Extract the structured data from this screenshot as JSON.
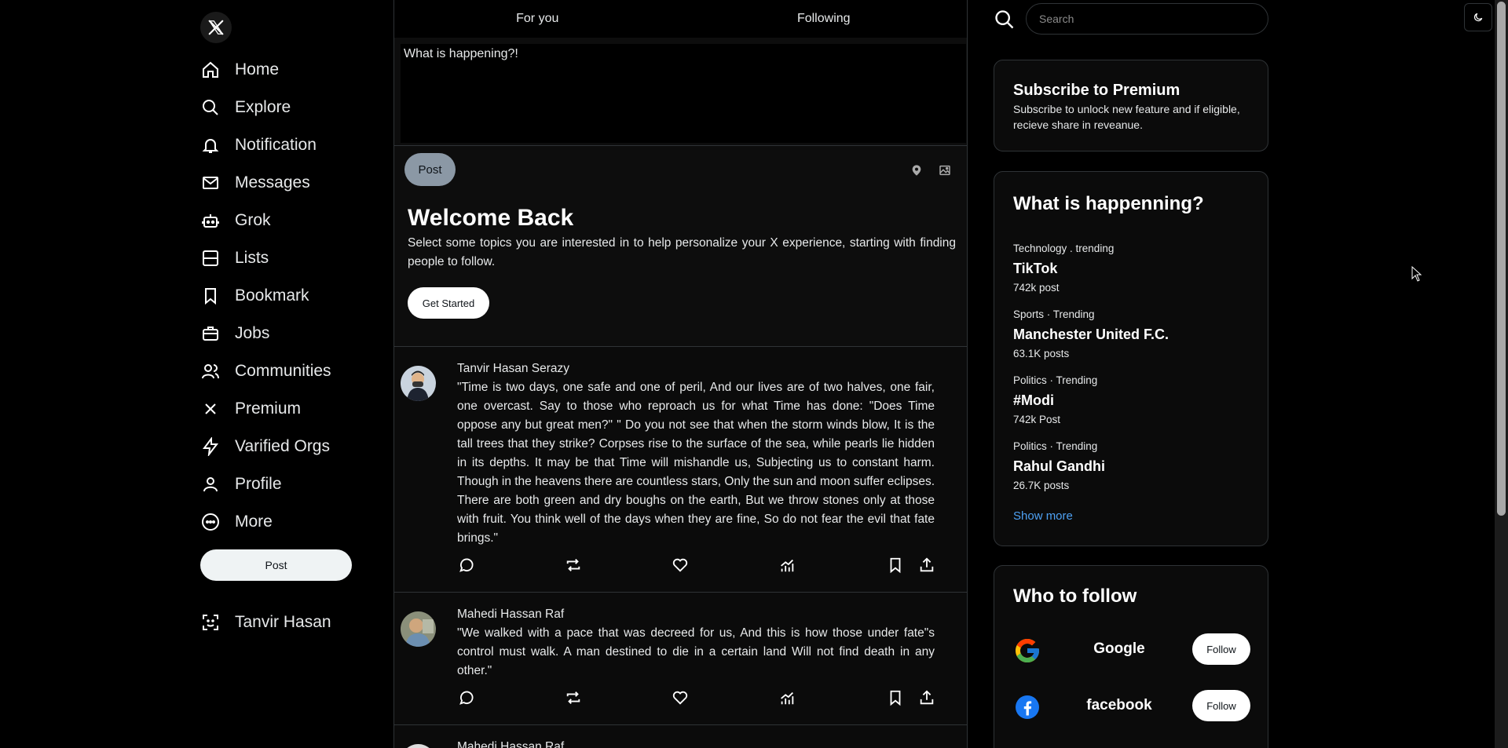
{
  "sidebar": {
    "logo": "x-logo",
    "items": [
      {
        "label": "Home",
        "icon": "home-icon"
      },
      {
        "label": "Explore",
        "icon": "search-icon"
      },
      {
        "label": "Notification",
        "icon": "bell-icon"
      },
      {
        "label": "Messages",
        "icon": "mail-icon"
      },
      {
        "label": "Grok",
        "icon": "robot-icon"
      },
      {
        "label": "Lists",
        "icon": "list-icon"
      },
      {
        "label": "Bookmark",
        "icon": "bookmark-icon"
      },
      {
        "label": "Jobs",
        "icon": "briefcase-icon"
      },
      {
        "label": "Communities",
        "icon": "people-icon"
      },
      {
        "label": "Premium",
        "icon": "x-icon"
      },
      {
        "label": "Varified Orgs",
        "icon": "lightning-icon"
      },
      {
        "label": "Profile",
        "icon": "user-icon"
      },
      {
        "label": "More",
        "icon": "more-icon"
      }
    ],
    "post_label": "Post",
    "user_name": "Tanvir Hasan"
  },
  "main": {
    "tabs": [
      {
        "label": "For you"
      },
      {
        "label": "Following"
      }
    ],
    "composer": {
      "placeholder": "What is happening?!",
      "post_label": "Post"
    },
    "welcome": {
      "title": "Welcome Back",
      "text": "Select some topics you are interested in to help personalize your X experience, starting with finding people to follow.",
      "button": "Get Started"
    },
    "tweets": [
      {
        "author": "Tanvir Hasan Serazy",
        "text": "\"Time is two days, one safe and one of peril, And our lives are of two halves, one fair, one overcast. Say to those who reproach us for what Time has done: \"Does Time oppose any but great men?\" \" Do you not see that when the storm winds blow, It is the tall trees that they strike? Corpses rise to the surface of the sea, while pearls lie hidden in its depths. It may be that Time will mishandle us, Subjecting us to constant harm. Though in the heavens there are countless stars, Only the sun and moon suffer eclipses. There are both green and dry boughs on the earth, But we throw stones only at those with fruit. You think well of the days when they are fine, So do not fear the evil that fate brings.\""
      },
      {
        "author": "Mahedi Hassan Raf",
        "text": "\"We walked with a pace that was decreed for us, And this is how those under fate\"s control must walk. A man destined to die in a certain land Will not find death in any other.\""
      },
      {
        "author": "Mahedi Hassan Raf",
        "text": ""
      }
    ]
  },
  "right": {
    "search_placeholder": "Search",
    "premium": {
      "title": "Subscribe to Premium",
      "text": "Subscribe to unlock new feature and if eligible, recieve share in reveanue."
    },
    "trending": {
      "title": "What is happenning?",
      "items": [
        {
          "category": "Technology . trending",
          "name": "TikTok",
          "count": "742k post"
        },
        {
          "category": "Sports · Trending",
          "name": "Manchester United F.C.",
          "count": "63.1K posts"
        },
        {
          "category": "Politics · Trending",
          "name": "#Modi",
          "count": "742k Post"
        },
        {
          "category": "Politics · Trending",
          "name": "Rahul Gandhi",
          "count": "26.7K posts"
        }
      ],
      "show_more": "Show more"
    },
    "who_to_follow": {
      "title": "Who to follow",
      "items": [
        {
          "name": "Google",
          "button": "Follow",
          "icon": "google-icon"
        },
        {
          "name": "facebook",
          "button": "Follow",
          "icon": "facebook-icon"
        }
      ]
    }
  },
  "colors": {
    "accent_link": "#4ea1f3",
    "background": "#000000",
    "text": "#e7e9ea"
  }
}
